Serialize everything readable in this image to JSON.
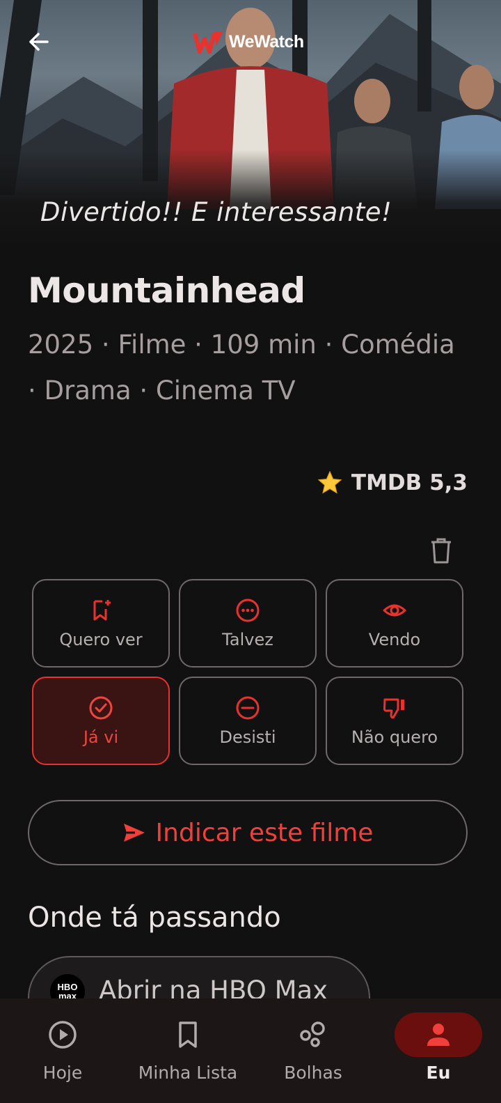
{
  "header": {
    "back_icon": "arrow-left-icon",
    "logo_text": "WeWatch"
  },
  "hero": {
    "tagline": "Divertido!! E interessante!"
  },
  "movie": {
    "title": "Mountainhead",
    "meta_line": "2025 · Filme · 109 min · Comédia · Drama · Cinema TV",
    "rating_label": "TMDB 5,3"
  },
  "status_buttons": [
    {
      "label": "Quero ver",
      "icon": "bookmark-add-icon",
      "active": false
    },
    {
      "label": "Talvez",
      "icon": "more-circle-icon",
      "active": false
    },
    {
      "label": "Vendo",
      "icon": "eye-icon",
      "active": false
    },
    {
      "label": "Já vi",
      "icon": "check-circle-icon",
      "active": true
    },
    {
      "label": "Desisti",
      "icon": "minus-circle-icon",
      "active": false
    },
    {
      "label": "Não quero",
      "icon": "thumbs-down-icon",
      "active": false
    }
  ],
  "recommend": {
    "label": "Indicar este filme"
  },
  "where_to_watch": {
    "heading": "Onde tá passando",
    "provider_button": "Abrir na HBO Max",
    "provider_logo_top": "HBO",
    "provider_logo_bottom": "max"
  },
  "bottom_nav": [
    {
      "label": "Hoje",
      "icon": "play-circle-icon",
      "active": false
    },
    {
      "label": "Minha Lista",
      "icon": "bookmark-icon",
      "active": false
    },
    {
      "label": "Bolhas",
      "icon": "bubbles-icon",
      "active": false
    },
    {
      "label": "Eu",
      "icon": "person-icon",
      "active": true
    }
  ],
  "colors": {
    "accent": "#e8322e",
    "background": "#121111",
    "nav_background": "#1c1616"
  }
}
